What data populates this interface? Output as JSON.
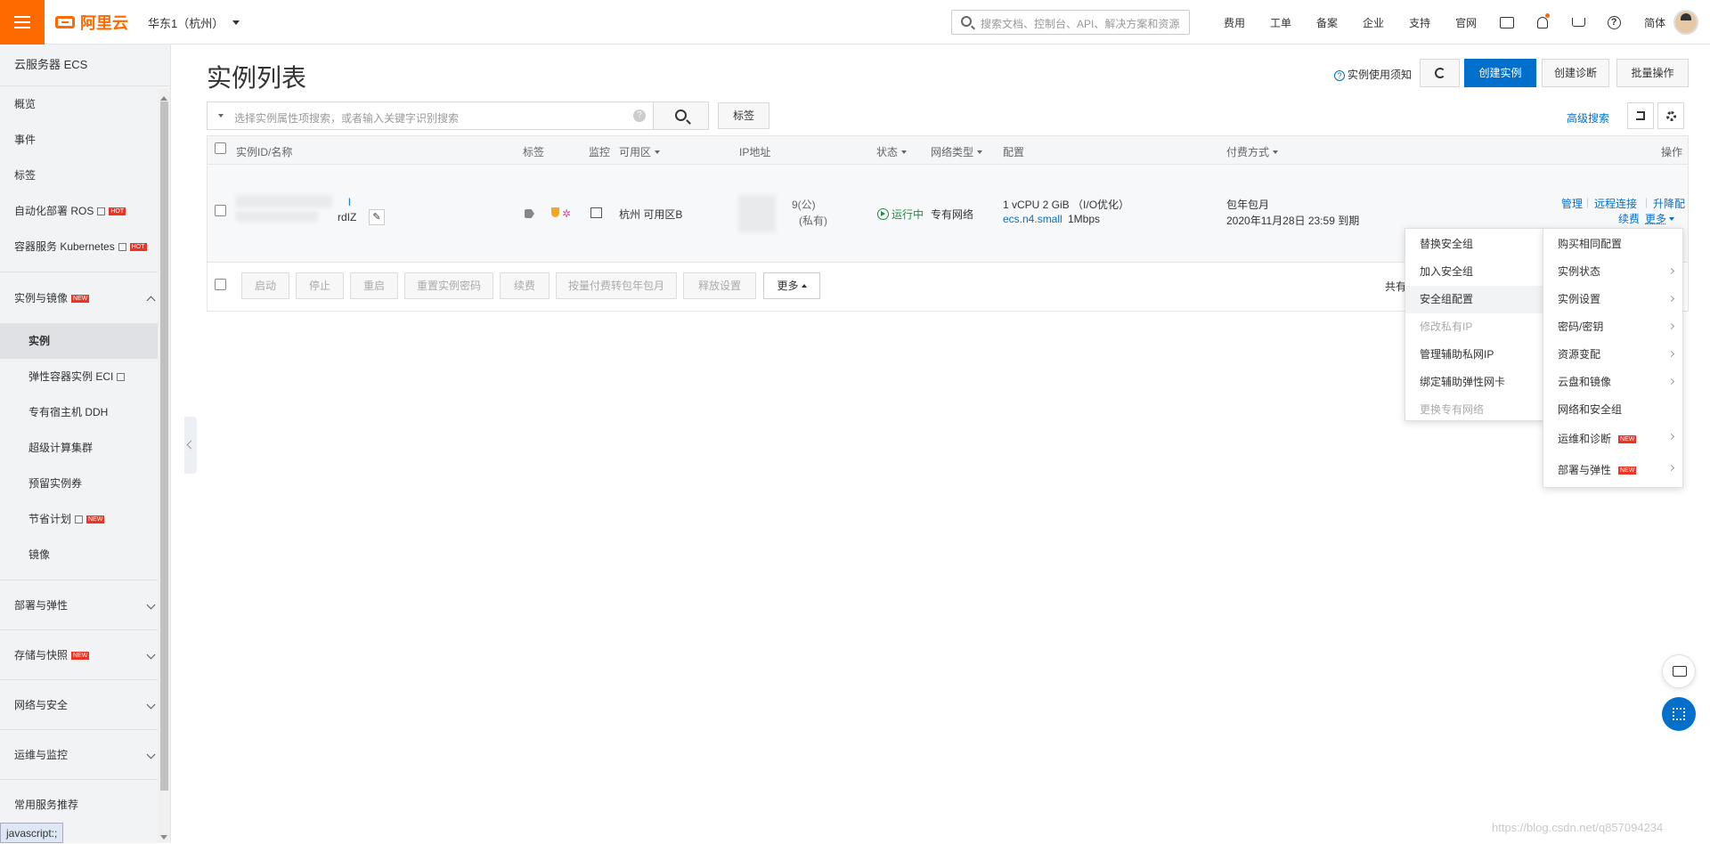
{
  "topbar": {
    "brand": "阿里云",
    "region": "华东1（杭州）",
    "search_placeholder": "搜索文档、控制台、API、解决方案和资源",
    "nav": [
      "费用",
      "工单",
      "备案",
      "企业",
      "支持",
      "官网"
    ],
    "lang": "简体",
    "icons": [
      "terminal-icon",
      "bell-icon",
      "cart-icon",
      "help-icon"
    ]
  },
  "sidebar": {
    "title": "云服务器 ECS",
    "items": [
      "概览",
      "事件",
      "标签",
      "自动化部署 ROS",
      "容器服务 Kubernetes"
    ],
    "hot_label": "HOT",
    "new_label": "NEW",
    "group_open": "实例与镜像",
    "sub_items": [
      "实例",
      "弹性容器实例 ECI",
      "专有宿主机 DDH",
      "超级计算集群",
      "预留实例券",
      "节省计划",
      "镜像"
    ],
    "groups": [
      "部署与弹性",
      "存储与快照",
      "网络与安全",
      "运维与监控"
    ],
    "recommend": "常用服务推荐"
  },
  "status_bar": "javascript:;",
  "main": {
    "title": "实例列表",
    "notice": "实例使用须知",
    "create_btn": "创建实例",
    "diag_btn": "创建诊断",
    "batch_btn": "批量操作",
    "filter_placeholder": "选择实例属性项搜索，或者输入关键字识别搜索",
    "tag_btn": "标签",
    "adv_search": "高级搜索"
  },
  "table": {
    "headers": {
      "id": "实例ID/名称",
      "tag": "标签",
      "monitor": "监控",
      "zone": "可用区",
      "ip": "IP地址",
      "status": "状态",
      "net": "网络类型",
      "config": "配置",
      "pay": "付费方式",
      "ops": "操作"
    },
    "row": {
      "id_tail1": "l",
      "id_tail2": "rdIZ",
      "zone": "杭州 可用区B",
      "ip_public": "9(公)",
      "ip_private": "(私有)",
      "status": "运行中",
      "net": "专有网络",
      "config1": "1 vCPU 2 GiB （I/O优化）",
      "spec": "ecs.n4.small",
      "bandwidth": "1Mbps",
      "pay": "包年包月",
      "expire": "2020年11月28日 23:59 到期",
      "ops": [
        "管理",
        "远程连接",
        "升降配",
        "续费",
        "更多"
      ]
    },
    "footer_buttons": [
      "启动",
      "停止",
      "重启",
      "重置实例密码",
      "续费",
      "按量付费转包年包月",
      "释放设置"
    ],
    "more_btn": "更多",
    "pager": "共有"
  },
  "dropdown_more": [
    {
      "label": "购买相同配置",
      "arrow": false
    },
    {
      "label": "实例状态",
      "arrow": true
    },
    {
      "label": "实例设置",
      "arrow": true
    },
    {
      "label": "密码/密钥",
      "arrow": true
    },
    {
      "label": "资源变配",
      "arrow": true
    },
    {
      "label": "云盘和镜像",
      "arrow": true
    },
    {
      "label": "网络和安全组",
      "arrow": false
    },
    {
      "label": "运维和诊断",
      "arrow": true,
      "new": true
    },
    {
      "label": "部署与弹性",
      "arrow": true,
      "new": true
    }
  ],
  "dropdown_sub": [
    {
      "label": "替换安全组",
      "disabled": false
    },
    {
      "label": "加入安全组",
      "disabled": false
    },
    {
      "label": "安全组配置",
      "disabled": false,
      "highlight": true
    },
    {
      "label": "修改私有IP",
      "disabled": true
    },
    {
      "label": "管理辅助私网IP",
      "disabled": false
    },
    {
      "label": "绑定辅助弹性网卡",
      "disabled": false
    },
    {
      "label": "更换专有网络",
      "disabled": true
    }
  ],
  "watermark": "https://blog.csdn.net/q857094234",
  "colors": {
    "brand": "#ff6a00",
    "primary": "#0070cc",
    "running": "#1e8e3e"
  }
}
